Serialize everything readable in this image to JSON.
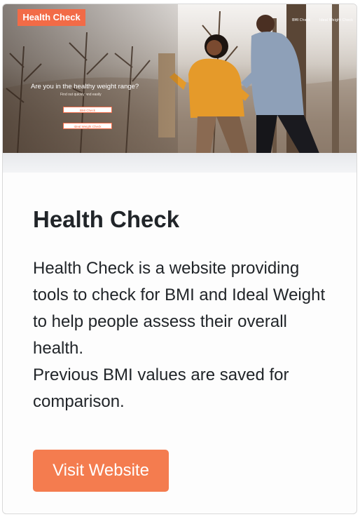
{
  "card": {
    "preview": {
      "logo": "Health Check",
      "nav": [
        "BMI Check",
        "Ideal Weight Check"
      ],
      "hero_title": "Are you in the healthy weight range?",
      "hero_subtitle": "Find out quickly and easily",
      "buttons": [
        "BMI Check",
        "Ideal Weight Check"
      ],
      "colors": {
        "brand": "#f26b47"
      }
    },
    "title": "Health Check",
    "description_lines": [
      "Health Check is a website providing tools to check for BMI and Ideal Weight to help people assess their overall health.",
      "Previous BMI values are saved for comparison."
    ],
    "button_label": "Visit Website",
    "colors": {
      "button": "#f47c4f",
      "text": "#212529"
    }
  }
}
